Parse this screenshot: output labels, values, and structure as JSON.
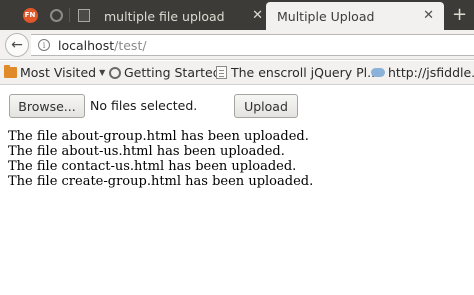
{
  "tabs": {
    "pinned": [
      {
        "icon": "fn-favicon",
        "label": "FN"
      },
      {
        "icon": "globe-icon"
      },
      {
        "icon": "document-icon"
      }
    ],
    "inactive_title": "multiple file upload",
    "active_title": "Multiple Upload",
    "close_glyph": "✕",
    "new_tab_glyph": "+"
  },
  "navbar": {
    "back_icon": "arrow-left-icon",
    "info_icon": "info-icon",
    "url_host": "localhost",
    "url_path": "/test/"
  },
  "bookmarks": [
    {
      "icon": "folder-icon",
      "label": "Most Visited",
      "has_dropdown": true
    },
    {
      "icon": "globe-icon",
      "label": "Getting Started"
    },
    {
      "icon": "page-icon",
      "label": "The enscroll jQuery Pl..."
    },
    {
      "icon": "cloud-icon",
      "label": "http://jsfiddle.n..."
    }
  ],
  "form": {
    "browse_label": "Browse...",
    "file_status": "No files selected.",
    "upload_label": "Upload"
  },
  "messages": [
    "The file about-group.html has been uploaded.",
    "The file about-us.html has been uploaded.",
    "The file contact-us.html has been uploaded.",
    "The file create-group.html has been uploaded."
  ],
  "colors": {
    "tabstrip": "#3c3b37",
    "toolbar": "#f2f1f0",
    "fn_favicon": "#e2572a"
  }
}
